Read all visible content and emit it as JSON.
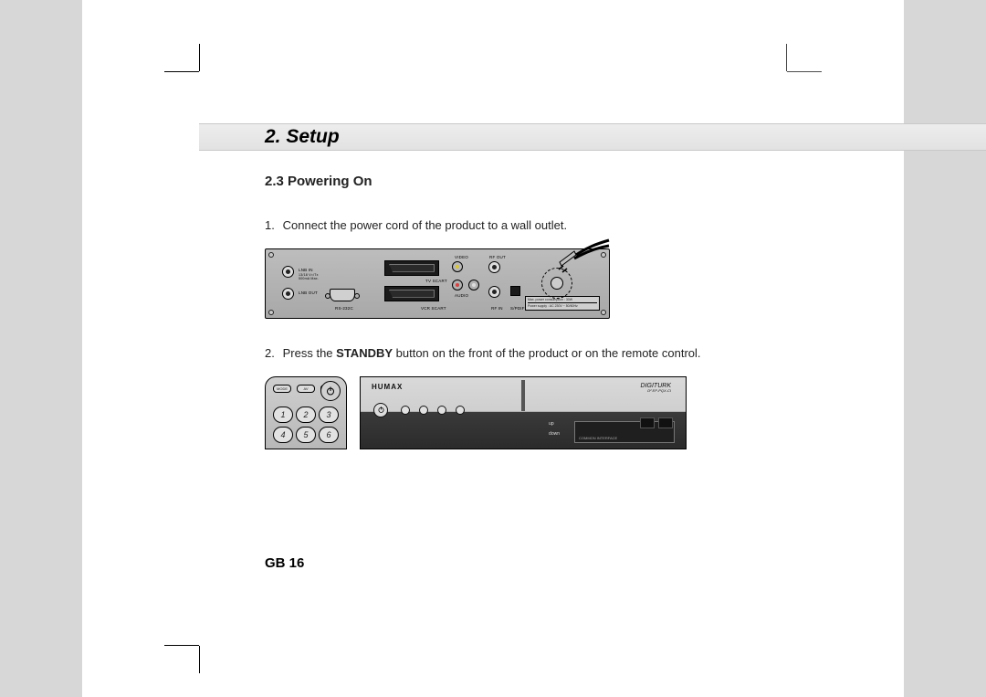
{
  "chapter_title": "2. Setup",
  "section_title": "2.3 Powering On",
  "steps": {
    "s1": {
      "num": "1.",
      "text": "Connect the power cord of the product to a wall outlet."
    },
    "s2": {
      "num": "2.",
      "before": "Press the ",
      "bold": "STANDBY",
      "after": " button on the front of the product or on the remote control."
    }
  },
  "rear": {
    "lnb_in": "LNB IN",
    "lnb_in_sub": "13/18 V=/Tx\n500mA Max.",
    "lnb_out": "LNB OUT",
    "rs232": "RS-232C",
    "tv_scart": "TV SCART",
    "vcr_scart": "VCR SCART",
    "video": "VIDEO",
    "audio": "AUDIO",
    "rf_out": "RF OUT",
    "rf_in": "RF IN",
    "spdif": "S/PDIF",
    "rating_line1": "Max. power consumption : 30W",
    "rating_line2": "Power supply : AC 230V ~ 50/60Hz"
  },
  "remote": {
    "mode": "MODE",
    "av": "AV",
    "standby": "STANDBY",
    "b1": "1",
    "b2": "2",
    "b3": "3",
    "b4": "4",
    "b5": "5",
    "b6": "6"
  },
  "front": {
    "brand": "HUMAX",
    "brand2": "DIGITURK",
    "model": "D² EP-PQX-CI",
    "flap_up": "up",
    "flap_down": "down",
    "ci": "COMMON INTERFACE"
  },
  "page_number": "GB 16"
}
